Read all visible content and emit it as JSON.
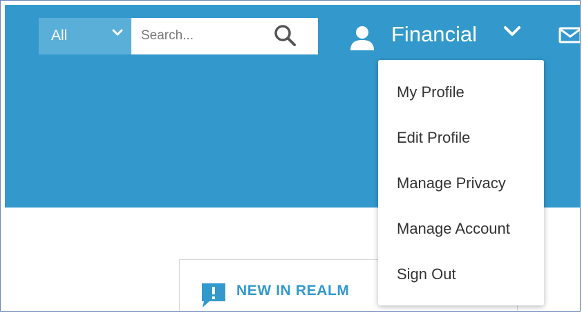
{
  "header": {
    "scope_select": {
      "value": "All"
    },
    "search": {
      "placeholder": "Search..."
    },
    "user": {
      "name": "Financial"
    }
  },
  "user_menu": {
    "items": [
      {
        "label": "My Profile"
      },
      {
        "label": "Edit Profile"
      },
      {
        "label": "Manage Privacy"
      },
      {
        "label": "Manage Account"
      },
      {
        "label": "Sign Out"
      }
    ]
  },
  "news": {
    "title": "NEW IN REALM"
  },
  "icons": {
    "search": "search-icon",
    "user": "user-icon",
    "mail": "envelope-icon",
    "chevron": "chevron-down-icon",
    "news": "speech-bubble-alert-icon"
  },
  "colors": {
    "banner": "#3399cc",
    "scope_select": "#5aafd9",
    "accent_text": "#3399cc"
  }
}
